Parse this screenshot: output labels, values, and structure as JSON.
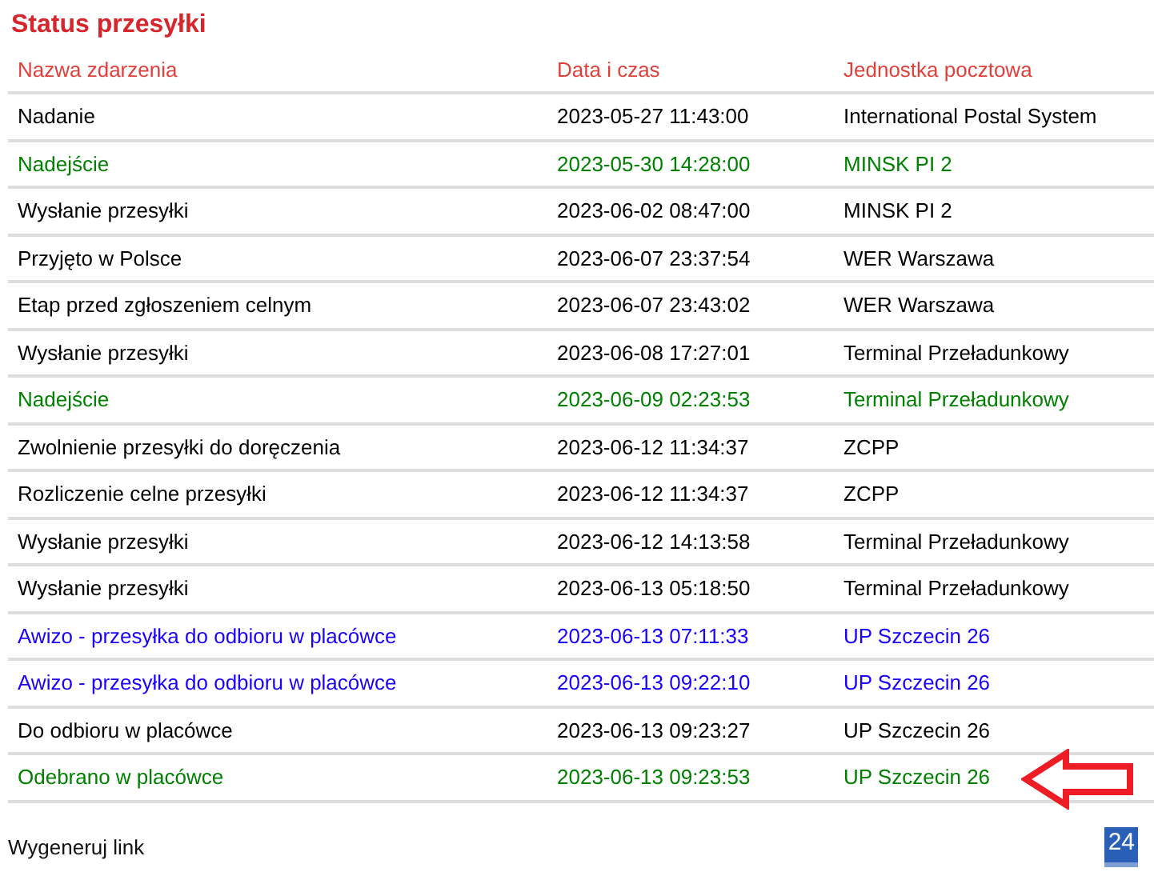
{
  "title": "Status przesyłki",
  "table": {
    "columns": [
      "Nazwa zdarzenia",
      "Data i czas",
      "Jednostka pocztowa"
    ],
    "rows": [
      {
        "cells": [
          "Nadanie",
          "2023-05-27 11:43:00",
          "International Postal System"
        ],
        "color": "#000000"
      },
      {
        "cells": [
          "Nadejście",
          "2023-05-30 14:28:00",
          "MINSK PI 2"
        ],
        "color": "#008000"
      },
      {
        "cells": [
          "Wysłanie przesyłki",
          "2023-06-02 08:47:00",
          "MINSK PI 2"
        ],
        "color": "#000000"
      },
      {
        "cells": [
          "Przyjęto w Polsce",
          "2023-06-07 23:37:54",
          "WER Warszawa"
        ],
        "color": "#000000"
      },
      {
        "cells": [
          "Etap przed zgłoszeniem celnym",
          "2023-06-07 23:43:02",
          "WER Warszawa"
        ],
        "color": "#000000"
      },
      {
        "cells": [
          "Wysłanie przesyłki",
          "2023-06-08 17:27:01",
          "Terminal Przeładunkowy"
        ],
        "color": "#000000"
      },
      {
        "cells": [
          "Nadejście",
          "2023-06-09 02:23:53",
          "Terminal Przeładunkowy"
        ],
        "color": "#008000"
      },
      {
        "cells": [
          "Zwolnienie przesyłki do doręczenia",
          "2023-06-12 11:34:37",
          "ZCPP"
        ],
        "color": "#000000"
      },
      {
        "cells": [
          "Rozliczenie celne przesyłki",
          "2023-06-12 11:34:37",
          "ZCPP"
        ],
        "color": "#000000"
      },
      {
        "cells": [
          "Wysłanie przesyłki",
          "2023-06-12 14:13:58",
          "Terminal Przeładunkowy"
        ],
        "color": "#000000"
      },
      {
        "cells": [
          "Wysłanie przesyłki",
          "2023-06-13 05:18:50",
          "Terminal Przeładunkowy"
        ],
        "color": "#000000"
      },
      {
        "cells": [
          "Awizo - przesyłka do odbioru w placówce",
          "2023-06-13 07:11:33",
          "UP Szczecin 26"
        ],
        "color": "#1a00ff"
      },
      {
        "cells": [
          "Awizo - przesyłka do odbioru w placówce",
          "2023-06-13 09:22:10",
          "UP Szczecin 26"
        ],
        "color": "#1a00ff"
      },
      {
        "cells": [
          "Do odbioru w placówce",
          "2023-06-13 09:23:27",
          "UP Szczecin 26"
        ],
        "color": "#000000"
      },
      {
        "cells": [
          "Odebrano w placówce",
          "2023-06-13 09:23:53",
          "UP Szczecin 26"
        ],
        "color": "#008000"
      }
    ]
  },
  "footer": {
    "link": "Wygeneruj link",
    "badge": "24"
  }
}
